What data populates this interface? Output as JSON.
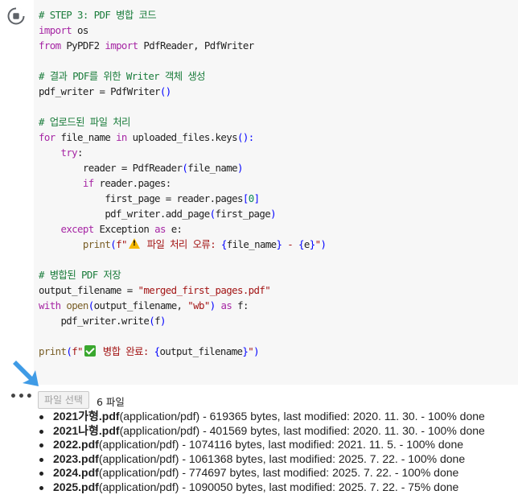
{
  "code": {
    "lines": [
      {
        "parts": [
          {
            "t": "# STEP 3: PDF 병합 코드",
            "c": "comment"
          }
        ]
      },
      {
        "parts": [
          {
            "t": "import",
            "c": "kw"
          },
          {
            "t": " os",
            "c": ""
          }
        ]
      },
      {
        "parts": [
          {
            "t": "from",
            "c": "kw"
          },
          {
            "t": " PyPDF2 ",
            "c": ""
          },
          {
            "t": "import",
            "c": "kw"
          },
          {
            "t": " PdfReader, PdfWriter",
            "c": ""
          }
        ]
      },
      {
        "parts": []
      },
      {
        "parts": [
          {
            "t": "# 결과 PDF를 위한 Writer 객체 생성",
            "c": "comment"
          }
        ]
      },
      {
        "parts": [
          {
            "t": "pdf_writer = PdfWriter",
            "c": ""
          },
          {
            "t": "()",
            "c": "brace"
          }
        ]
      },
      {
        "parts": []
      },
      {
        "parts": [
          {
            "t": "# 업로드된 파일 처리",
            "c": "comment"
          }
        ]
      },
      {
        "parts": [
          {
            "t": "for",
            "c": "kw"
          },
          {
            "t": " file_name ",
            "c": ""
          },
          {
            "t": "in",
            "c": "kw"
          },
          {
            "t": " uploaded_files.keys",
            "c": ""
          },
          {
            "t": "():",
            "c": "brace"
          }
        ]
      },
      {
        "parts": [
          {
            "t": "    ",
            "c": ""
          },
          {
            "t": "try",
            "c": "kw"
          },
          {
            "t": ":",
            "c": ""
          }
        ]
      },
      {
        "parts": [
          {
            "t": "        reader = PdfReader",
            "c": ""
          },
          {
            "t": "(",
            "c": "brace"
          },
          {
            "t": "file_name",
            "c": ""
          },
          {
            "t": ")",
            "c": "brace"
          }
        ]
      },
      {
        "parts": [
          {
            "t": "        ",
            "c": ""
          },
          {
            "t": "if",
            "c": "kw"
          },
          {
            "t": " reader.pages:",
            "c": ""
          }
        ]
      },
      {
        "parts": [
          {
            "t": "            first_page = reader.pages",
            "c": ""
          },
          {
            "t": "[",
            "c": "brace"
          },
          {
            "t": "0",
            "c": "num"
          },
          {
            "t": "]",
            "c": "brace"
          }
        ]
      },
      {
        "parts": [
          {
            "t": "            pdf_writer.add_page",
            "c": ""
          },
          {
            "t": "(",
            "c": "brace"
          },
          {
            "t": "first_page",
            "c": ""
          },
          {
            "t": ")",
            "c": "brace"
          }
        ]
      },
      {
        "parts": [
          {
            "t": "    ",
            "c": ""
          },
          {
            "t": "except",
            "c": "kw"
          },
          {
            "t": " Exception ",
            "c": ""
          },
          {
            "t": "as",
            "c": "kw"
          },
          {
            "t": " e:",
            "c": ""
          }
        ]
      },
      {
        "parts": [
          {
            "t": "        ",
            "c": ""
          },
          {
            "t": "print",
            "c": "fn"
          },
          {
            "t": "(",
            "c": "brace"
          },
          {
            "t": "f\"",
            "c": "str"
          },
          {
            "t": "",
            "c": "warn"
          },
          {
            "t": " 파일 처리 오류: ",
            "c": "str"
          },
          {
            "t": "{",
            "c": "brace"
          },
          {
            "t": "file_name",
            "c": ""
          },
          {
            "t": "}",
            "c": "brace"
          },
          {
            "t": " - ",
            "c": "str"
          },
          {
            "t": "{",
            "c": "brace"
          },
          {
            "t": "e",
            "c": ""
          },
          {
            "t": "}",
            "c": "brace"
          },
          {
            "t": "\"",
            "c": "str"
          },
          {
            "t": ")",
            "c": "brace"
          }
        ]
      },
      {
        "parts": []
      },
      {
        "parts": [
          {
            "t": "# 병합된 PDF 저장",
            "c": "comment"
          }
        ]
      },
      {
        "parts": [
          {
            "t": "output_filename = ",
            "c": ""
          },
          {
            "t": "\"merged_first_pages.pdf\"",
            "c": "str"
          }
        ]
      },
      {
        "parts": [
          {
            "t": "with",
            "c": "kw"
          },
          {
            "t": " ",
            "c": ""
          },
          {
            "t": "open",
            "c": "fn"
          },
          {
            "t": "(",
            "c": "brace"
          },
          {
            "t": "output_filename, ",
            "c": ""
          },
          {
            "t": "\"wb\"",
            "c": "str"
          },
          {
            "t": ")",
            "c": "brace"
          },
          {
            "t": " ",
            "c": ""
          },
          {
            "t": "as",
            "c": "kw"
          },
          {
            "t": " f:",
            "c": ""
          }
        ]
      },
      {
        "parts": [
          {
            "t": "    pdf_writer.write",
            "c": ""
          },
          {
            "t": "(",
            "c": "brace"
          },
          {
            "t": "f",
            "c": ""
          },
          {
            "t": ")",
            "c": "brace"
          }
        ]
      },
      {
        "parts": []
      },
      {
        "parts": [
          {
            "t": "print",
            "c": "fn"
          },
          {
            "t": "(",
            "c": "brace"
          },
          {
            "t": "f\"",
            "c": "str"
          },
          {
            "t": "",
            "c": "check"
          },
          {
            "t": " 병합 완료: ",
            "c": "str"
          },
          {
            "t": "{",
            "c": "brace"
          },
          {
            "t": "output_filename",
            "c": ""
          },
          {
            "t": "}",
            "c": "brace"
          },
          {
            "t": "\"",
            "c": "str"
          },
          {
            "t": ")",
            "c": "brace"
          }
        ]
      }
    ]
  },
  "output": {
    "file_button_label": "파일 선택",
    "file_count": "6 파일",
    "files": [
      {
        "name": "2021가형.pdf",
        "detail": "(application/pdf) - 619365 bytes, last modified: 2020. 11. 30. - 100% done"
      },
      {
        "name": "2021나형.pdf",
        "detail": "(application/pdf) - 401569 bytes, last modified: 2020. 11. 30. - 100% done"
      },
      {
        "name": "2022.pdf",
        "detail": "(application/pdf) - 1074116 bytes, last modified: 2021. 11. 5. - 100% done"
      },
      {
        "name": "2023.pdf",
        "detail": "(application/pdf) - 1061368 bytes, last modified: 2025. 7. 22. - 100% done"
      },
      {
        "name": "2024.pdf",
        "detail": "(application/pdf) - 774697 bytes, last modified: 2025. 7. 22. - 100% done"
      },
      {
        "name": "2025.pdf",
        "detail": "(application/pdf) - 1090050 bytes, last modified: 2025. 7. 22. - 75% done"
      }
    ]
  },
  "icons": {
    "run": "run-cell-icon",
    "menu": "more-horizontal-icon",
    "arrow": "arrow-down-right-icon",
    "warning": "warning-icon",
    "check": "check-mark-icon"
  },
  "colors": {
    "editor_bg": "#f7f7f7",
    "comment": "#1a7c3b",
    "keyword": "#a626a4",
    "string": "#a31515",
    "arrow": "#3f9be6"
  }
}
